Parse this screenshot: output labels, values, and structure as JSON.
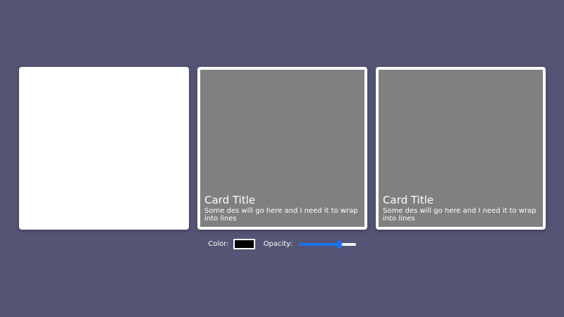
{
  "cards": [
    {
      "variant": "blank"
    },
    {
      "variant": "overlay",
      "title": "Card Title",
      "description": "Some des will go here and I need it to wrap into lines"
    },
    {
      "variant": "overlay",
      "title": "Card Title",
      "description": "Some des will go here and I need it to wrap into lines"
    }
  ],
  "controls": {
    "color_label": "Color:",
    "color_value": "#000000",
    "opacity_label": "Opacity:",
    "opacity_value": 0.7
  },
  "colors": {
    "background": "#545475",
    "card_overlay": "#808080",
    "accent": "#1a73e8"
  }
}
